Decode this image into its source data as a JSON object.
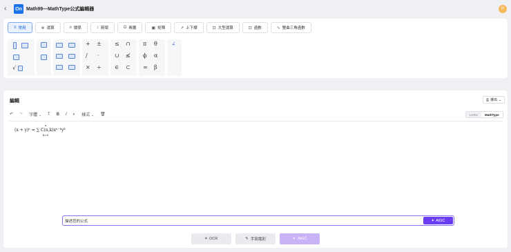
{
  "app": {
    "title": "Math99—MathType公式編輯器",
    "logo_text": "On",
    "avatar_initial": "P",
    "back_icon": "chevron-left-icon"
  },
  "tabs": [
    {
      "label": "常用",
      "icon": "≡",
      "active": true
    },
    {
      "label": "運算",
      "icon": "※"
    },
    {
      "label": "關係",
      "icon": "≥"
    },
    {
      "label": "箭頭",
      "icon": "↕"
    },
    {
      "label": "希臘",
      "icon": "Ω"
    },
    {
      "label": "矩陣",
      "icon": "▣"
    },
    {
      "label": "上下標",
      "icon": "↗"
    },
    {
      "label": "大型運算",
      "icon": "⊡"
    },
    {
      "label": "函數",
      "icon": "⊡"
    },
    {
      "label": "雙曲三角函數",
      "icon": "∿"
    }
  ],
  "symbols": {
    "g1": [
      "√",
      "⁄"
    ],
    "g4": [
      "+",
      "±",
      "/",
      "·",
      "×",
      "÷"
    ],
    "g5": [
      "≤",
      "∩",
      "∪",
      "≰",
      "∈",
      "⊂"
    ],
    "g6": [
      "π",
      "θ",
      "ϕ",
      "α",
      "∞",
      "β"
    ],
    "g7": [
      "∠"
    ]
  },
  "editor": {
    "title": "編輯",
    "export_label": "導出",
    "font_label": "字體",
    "style_label": "樣式",
    "format_bold": "B",
    "format_italic": "I",
    "format_text": "T",
    "toggle": [
      "LaTex",
      "MathType"
    ],
    "formula": "(x + y)ⁿ = ∑ C(n,k)xⁿ⁻ᵏyᵏ",
    "formula_sum_top": "n",
    "formula_sum_bottom": "k=0"
  },
  "ai": {
    "placeholder": "描述您的公式",
    "value": "描述您的公式",
    "submit_label": "AIGC"
  },
  "bottom": {
    "ocr_label": "OCR",
    "handwrite_label": "手寫識別",
    "aigc_label": "AIGC"
  }
}
